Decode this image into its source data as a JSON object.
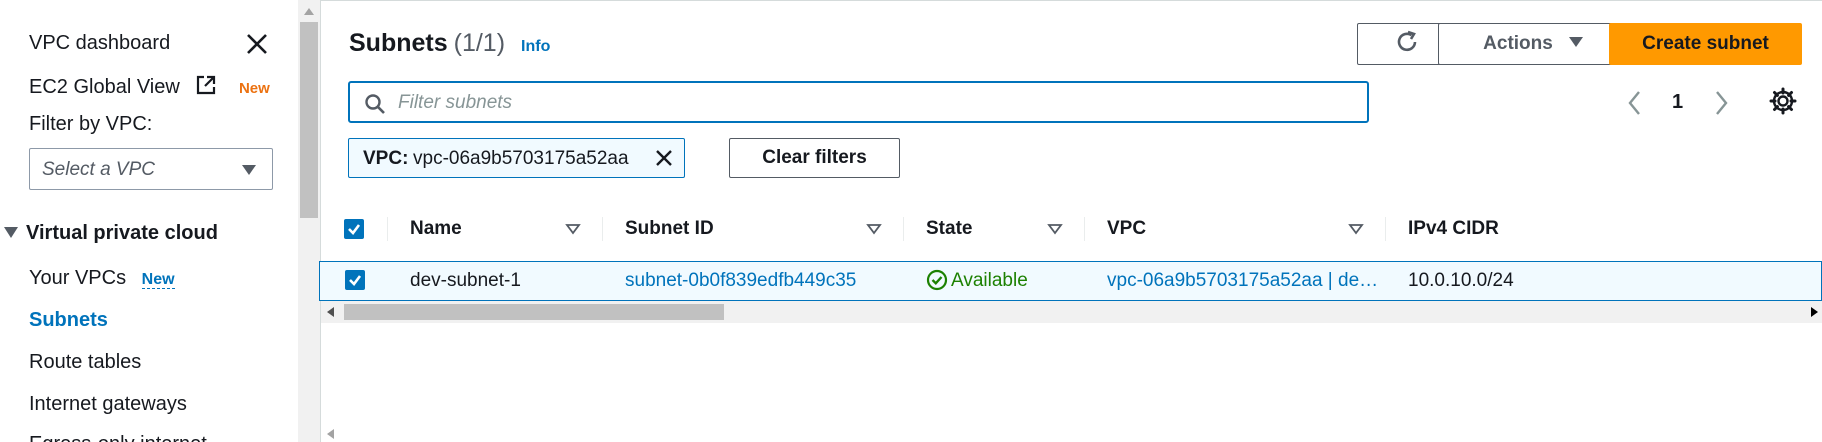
{
  "sidebar": {
    "dashboard": "VPC dashboard",
    "ec2_global_view": "EC2 Global View",
    "ec2_global_view_badge": "New",
    "filter_label": "Filter by VPC:",
    "vpc_select_placeholder": "Select a VPC",
    "section_title": "Virtual private cloud",
    "items": [
      {
        "label": "Your VPCs",
        "badge": "New"
      },
      {
        "label": "Subnets"
      },
      {
        "label": "Route tables"
      },
      {
        "label": "Internet gateways"
      },
      {
        "label": "Egress-only internet"
      }
    ]
  },
  "header": {
    "title": "Subnets",
    "count": "(1/1)",
    "info": "Info",
    "actions_label": "Actions",
    "create_label": "Create subnet"
  },
  "search": {
    "placeholder": "Filter subnets"
  },
  "pagination": {
    "current_page": "1"
  },
  "filter_token": {
    "key": "VPC:",
    "value": "vpc-06a9b5703175a52aa"
  },
  "clear_filters_label": "Clear filters",
  "table": {
    "columns": [
      "Name",
      "Subnet ID",
      "State",
      "VPC",
      "IPv4 CIDR"
    ],
    "rows": [
      {
        "selected": true,
        "name": "dev-subnet-1",
        "subnet_id": "subnet-0b0f839edfb449c35",
        "state": "Available",
        "vpc": "vpc-06a9b5703175a52aa | de…",
        "ipv4_cidr": "10.0.10.0/24"
      }
    ]
  },
  "colors": {
    "accent": "#0073bb",
    "primary_button": "#ff9900",
    "success": "#1d8102"
  }
}
